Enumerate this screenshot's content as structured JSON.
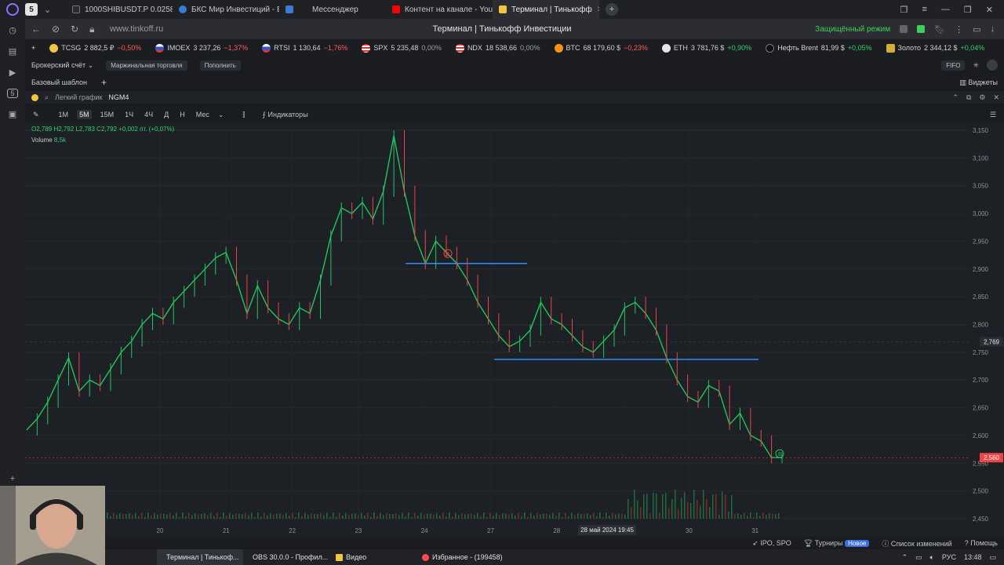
{
  "browser": {
    "badge": "5",
    "tabs": [
      {
        "label": "1000SHIBUSDT.P 0.02586",
        "color": "#2b2b2b"
      },
      {
        "label": "БКС Мир Инвестиций - В",
        "color": "#3a7bd5"
      },
      {
        "label": "Мессенджер",
        "color": "#3a7bd5"
      },
      {
        "label": "Контент на канале - YouT",
        "color": "#ff0000"
      },
      {
        "label": "Терминал | Тинькофф",
        "color": "#f4c542"
      }
    ],
    "url": "www.tinkoff.ru",
    "page_title": "Терминал | Тинькофф Инвестиции",
    "secure_mode": "Защищённый режим"
  },
  "tickers": [
    {
      "name": "TCSG",
      "value": "2 882,5 ₽",
      "change": "−0,50%",
      "dir": "neg",
      "color": "#f4c542"
    },
    {
      "name": "IMOEX",
      "value": "3 237,26",
      "change": "−1,37%",
      "dir": "neg",
      "color": "#d33"
    },
    {
      "name": "RTSI",
      "value": "1 130,64",
      "change": "−1,76%",
      "dir": "neg",
      "color": "#d33"
    },
    {
      "name": "SPX",
      "value": "5 235,48",
      "change": "0,00%",
      "dir": "neu",
      "color": "#3a5fcd"
    },
    {
      "name": "NDX",
      "value": "18 538,66",
      "change": "0,00%",
      "dir": "neu",
      "color": "#3a5fcd"
    },
    {
      "name": "BTC",
      "value": "68 179,60 $",
      "change": "−0,23%",
      "dir": "neg",
      "color": "#f7931a"
    },
    {
      "name": "ETH",
      "value": "3 781,76 $",
      "change": "+0,90%",
      "dir": "pos",
      "color": "#e5e5e5"
    },
    {
      "name": "Нефть Brent",
      "value": "81,99 $",
      "change": "+0,05%",
      "dir": "pos",
      "color": "#222"
    },
    {
      "name": "Золото",
      "value": "2 344,12 $",
      "change": "+0,04%",
      "dir": "pos",
      "color": "#d4af37"
    }
  ],
  "account": {
    "label": "Брокерский счёт",
    "margin": "Маржинальная торговля",
    "topup": "Пополнить",
    "fifo": "FIFO"
  },
  "template": {
    "label": "Базовый шаблон",
    "widgets": "Виджеты"
  },
  "widget": {
    "chart_type": "Легкий график",
    "ticker": "NGM4"
  },
  "toolbar": {
    "timeframes": [
      "1M",
      "5M",
      "15M",
      "1Ч",
      "4Ч",
      "Д",
      "Н",
      "Мес"
    ],
    "active": "5M",
    "indicators": "Индикаторы"
  },
  "ohlc": "O2,789  H2,792  L2,783  C2,792  +0,002 пт. (+0,07%)",
  "volume": {
    "label": "Volume",
    "value": "8,5k"
  },
  "crosshair": {
    "price": "2,769",
    "time": "28 май 2024 19:45"
  },
  "chart_data": {
    "type": "line",
    "title": "",
    "x_categories": [
      "20",
      "21",
      "22",
      "23",
      "24",
      "27",
      "28",
      "29",
      "30",
      "31"
    ],
    "y_ticks": [
      "3,150",
      "3,100",
      "3,050",
      "3,000",
      "2,950",
      "2,900",
      "2,850",
      "2,800",
      "2,750",
      "2,700",
      "2,650",
      "2,600",
      "2,550",
      "2,500",
      "2,450"
    ],
    "ylim": [
      2450,
      3150
    ],
    "last_price": "2,560",
    "series": [
      {
        "name": "",
        "values": [
          2610,
          2630,
          2660,
          2700,
          2740,
          2680,
          2700,
          2690,
          2720,
          2750,
          2770,
          2800,
          2820,
          2810,
          2840,
          2860,
          2880,
          2900,
          2920,
          2930,
          2880,
          2820,
          2870,
          2830,
          2810,
          2800,
          2830,
          2820,
          2880,
          2960,
          3010,
          3000,
          3020,
          2990,
          3040,
          3140,
          3040,
          2960,
          2910,
          2950,
          2930,
          2910,
          2880,
          2840,
          2810,
          2780,
          2760,
          2770,
          2790,
          2840,
          2810,
          2800,
          2780,
          2760,
          2750,
          2770,
          2790,
          2830,
          2840,
          2820,
          2790,
          2740,
          2700,
          2670,
          2660,
          2690,
          2680,
          2620,
          2640,
          2600,
          2590,
          2560,
          2560
        ]
      }
    ],
    "levels": [
      2910,
      2737
    ],
    "grid": true,
    "annotations": [
      "8",
      "8"
    ]
  },
  "bottom": {
    "ipo": "IPO, SPO",
    "tournaments": "Турниры",
    "new_badge": "Новое",
    "changes": "Список изменений",
    "help": "Помощь"
  },
  "taskbar": {
    "items": [
      {
        "label": "Терминал | Тинькоф...",
        "color": "#ff4b4b"
      },
      {
        "label": "OBS 30.0.0 - Профил...",
        "color": "#ddd"
      },
      {
        "label": "Видео",
        "color": "#f4c542"
      },
      {
        "label": "Избранное - (199458)",
        "color": "#ff4b4b"
      }
    ],
    "lang": "РУС",
    "time": "13:48"
  }
}
